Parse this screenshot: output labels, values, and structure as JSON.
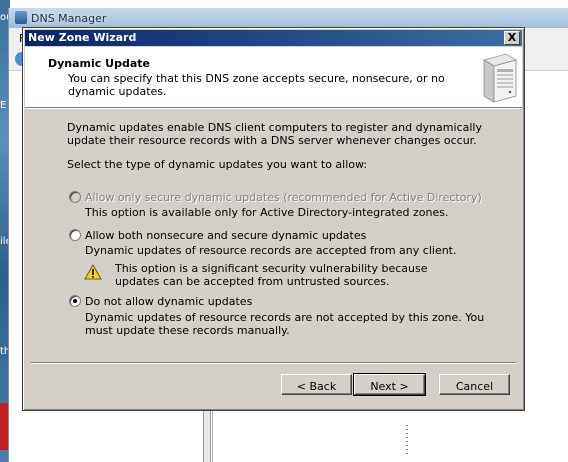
{
  "background": {
    "window_title": "DNS Manager",
    "menu_first_letter": "F",
    "left_strip_labels": [
      "ou",
      "E",
      "ile",
      "th"
    ]
  },
  "wizard": {
    "title": "New Zone Wizard",
    "close_label": "X",
    "header": {
      "title": "Dynamic Update",
      "subtitle": "You can specify that this DNS zone accepts secure, nonsecure, or no dynamic updates."
    },
    "intro": "Dynamic updates enable DNS client computers to register and dynamically update their resource records with a DNS server whenever changes occur.",
    "prompt": "Select the type of dynamic updates you want to allow:",
    "options": [
      {
        "label": "Allow only secure dynamic updates (recommended for Active Directory)",
        "description": "This option is available only for Active Directory-integrated zones.",
        "enabled": false,
        "selected": false
      },
      {
        "label": "Allow both nonsecure and secure dynamic updates",
        "description": "Dynamic updates of resource records are accepted from any client.",
        "warning": "This option is a significant security vulnerability because updates can be accepted from untrusted sources.",
        "enabled": true,
        "selected": false
      },
      {
        "label": "Do not allow dynamic updates",
        "description": "Dynamic updates of resource records are not accepted by this zone. You must update these records manually.",
        "enabled": true,
        "selected": true
      }
    ],
    "buttons": {
      "back": "< Back",
      "next": "Next >",
      "cancel": "Cancel"
    }
  },
  "colors": {
    "dialog_face": "#d4d0c8",
    "title_bar_start": "#0a246a",
    "title_bar_end": "#3a6ea5",
    "disabled_text": "#808080"
  },
  "icons": [
    "server-icon",
    "warning-icon",
    "close-icon",
    "back-arrow-icon"
  ]
}
